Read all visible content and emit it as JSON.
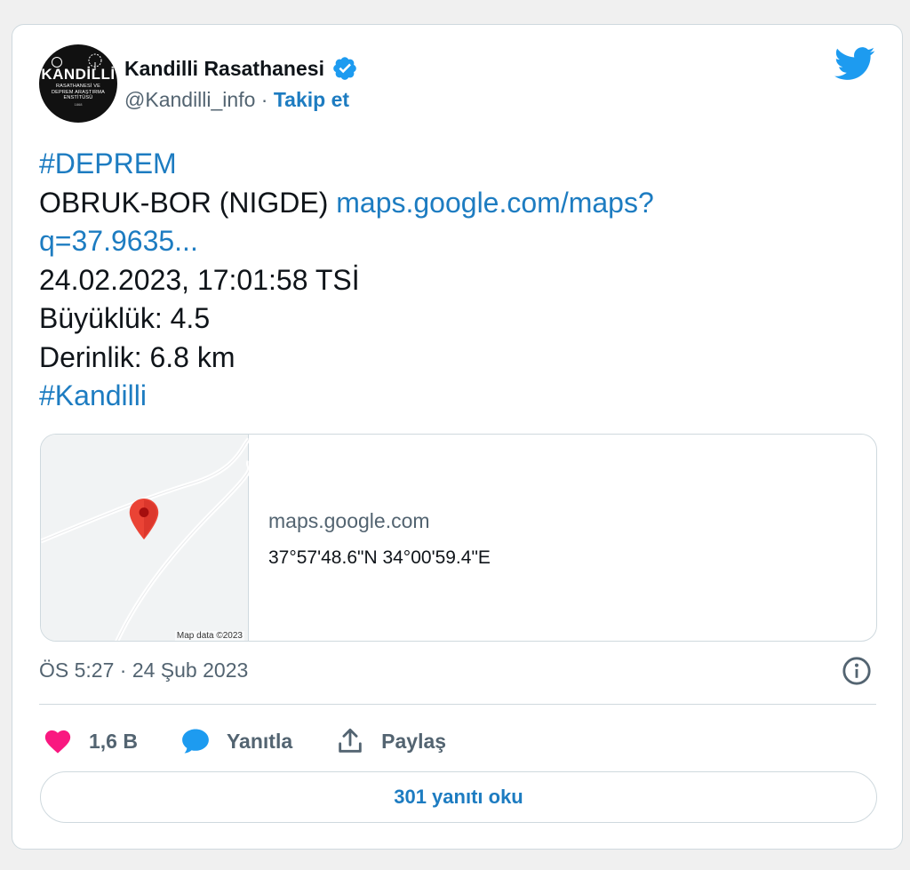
{
  "author": {
    "display_name": "Kandilli Rasathanesi",
    "handle": "@Kandilli_info",
    "separator": "·",
    "follow_label": "Takip et",
    "avatar": {
      "title": "KANDİLLİ",
      "subtitle_1": "RASATHANESİ VE",
      "subtitle_2": "DEPREM ARAŞTIRMA",
      "subtitle_3": "ENSTİTÜSÜ",
      "year": "1868"
    }
  },
  "tweet": {
    "hashtag_1": "#DEPREM",
    "location": "OBRUK-BOR (NIGDE) ",
    "link_line_1": "maps.google.com/maps?",
    "link_line_2": "q=37.9635...",
    "datetime": "24.02.2023, 17:01:58 TSİ",
    "magnitude": "Büyüklük: 4.5",
    "depth": "Derinlik: 6.8 km",
    "hashtag_2": "#Kandilli"
  },
  "link_card": {
    "domain": "maps.google.com",
    "title": "37°57'48.6\"N 34°00'59.4\"E",
    "map_credit": "Map data ©2023"
  },
  "meta": {
    "timestamp": "ÖS 5:27 · 24 Şub 2023"
  },
  "actions": {
    "likes": "1,6 B",
    "reply_label": "Yanıtla",
    "share_label": "Paylaş"
  },
  "read_replies_label": "301 yanıtı oku",
  "colors": {
    "link": "#1d7cc1",
    "twitter_blue": "#1d9bf0",
    "like_pink": "#f91880",
    "secondary_text": "#536471",
    "border": "#cfd9de",
    "map_pin": "#ea4335"
  }
}
